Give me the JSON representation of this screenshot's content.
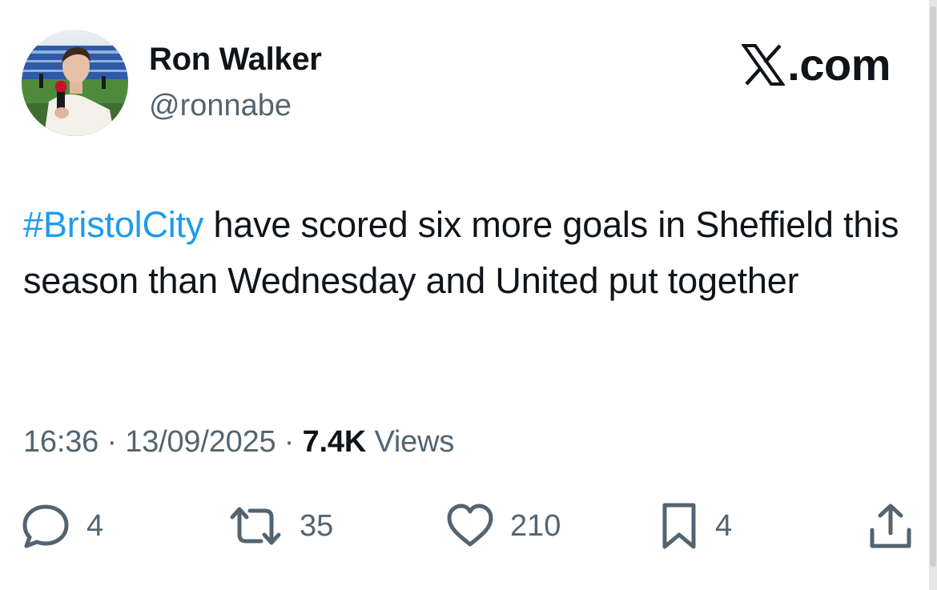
{
  "author": {
    "display_name": "Ron Walker",
    "handle": "@ronnabe"
  },
  "brand": {
    "label": ".com",
    "icon": "x-logo-icon"
  },
  "tweet": {
    "hashtag": "#BristolCity",
    "text": " have scored six more goals in Sheffield this season than Wednesday and United put together"
  },
  "meta": {
    "time": "16:36",
    "sep1": " · ",
    "date": "13/09/2025",
    "sep2": " · ",
    "views_count": "7.4K",
    "views_label": " Views"
  },
  "actions": {
    "reply": {
      "icon": "reply-icon",
      "count": "4"
    },
    "retweet": {
      "icon": "retweet-icon",
      "count": "35"
    },
    "like": {
      "icon": "heart-icon",
      "count": "210"
    },
    "bookmark": {
      "icon": "bookmark-icon",
      "count": "4"
    },
    "share": {
      "icon": "share-icon"
    }
  },
  "colors": {
    "text": "#0f1419",
    "secondary": "#536471",
    "link": "#1d9bf0",
    "background": "#ffffff"
  }
}
